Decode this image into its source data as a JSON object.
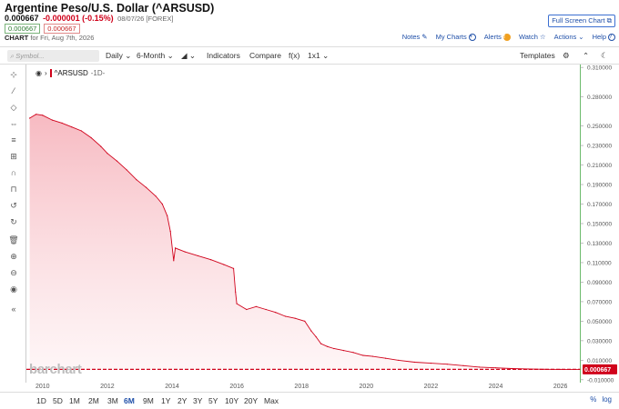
{
  "header": {
    "title": "Argentine Peso/U.S. Dollar (^ARSUSD)",
    "last": "0.000667",
    "change": "-0.000001 (-0.15%)",
    "meta": "08/07/26 [FOREX]",
    "bid": "0.000667",
    "ask": "0.000667",
    "chart_label": "CHART",
    "chart_date": "for Fri, Aug 7th, 2026",
    "fullscreen_label": "Full Screen Chart",
    "links": {
      "notes": "Notes",
      "mycharts": "My Charts",
      "alerts": "Alerts",
      "watch": "Watch",
      "actions": "Actions",
      "help": "Help"
    }
  },
  "toolbar": {
    "symbol_placeholder": "Symbol...",
    "period": "Daily",
    "range": "6-Month",
    "indicators": "Indicators",
    "compare": "Compare",
    "fx": "f(x)",
    "layout": "1x1",
    "templates": "Templates"
  },
  "legend": {
    "symbol": "^ARSUSD",
    "timeframe": "-1D-"
  },
  "watermark": "barchart",
  "ranges": [
    "1D",
    "5D",
    "1M",
    "2M",
    "3M",
    "6M",
    "9M",
    "1Y",
    "2Y",
    "3Y",
    "5Y",
    "10Y",
    "20Y",
    "Max"
  ],
  "active_range": "6M",
  "bottom_links": {
    "log": "log"
  },
  "colors": {
    "line": "#d0021b",
    "fill": "#f9cfd4",
    "accent": "#1f4fa8",
    "last_price_tag": "#d0021b"
  },
  "chart_data": {
    "type": "area",
    "title": "",
    "xlabel": "",
    "ylabel": "",
    "xlim": [
      2009.5,
      2026.6
    ],
    "ylim": [
      -0.012,
      0.312
    ],
    "y_ticks": [
      "0.310000",
      "0.280000",
      "0.250000",
      "0.230000",
      "0.210000",
      "0.190000",
      "0.170000",
      "0.150000",
      "0.130000",
      "0.110000",
      "0.090000",
      "0.070000",
      "0.050000",
      "0.030000",
      "0.010000",
      "-0.010000"
    ],
    "y_tick_values": [
      0.31,
      0.28,
      0.25,
      0.23,
      0.21,
      0.19,
      0.17,
      0.15,
      0.13,
      0.11,
      0.09,
      0.07,
      0.05,
      0.03,
      0.01,
      -0.01
    ],
    "x_ticks": [
      "2010",
      "2012",
      "2014",
      "2016",
      "2018",
      "2020",
      "2022",
      "2024",
      "2026"
    ],
    "x_tick_values": [
      2010,
      2012,
      2014,
      2016,
      2018,
      2020,
      2022,
      2024,
      2026
    ],
    "last_value": 0.000667,
    "last_value_label": "0.000667",
    "series": [
      {
        "name": "^ARSUSD",
        "x": [
          2009.6,
          2009.8,
          2010.0,
          2010.3,
          2010.6,
          2010.9,
          2011.2,
          2011.5,
          2011.8,
          2012.0,
          2012.3,
          2012.6,
          2012.9,
          2013.2,
          2013.5,
          2013.7,
          2013.85,
          2013.95,
          2014.05,
          2014.1,
          2014.4,
          2014.8,
          2015.2,
          2015.6,
          2015.9,
          2015.96,
          2016.0,
          2016.3,
          2016.6,
          2016.9,
          2017.2,
          2017.5,
          2017.8,
          2018.1,
          2018.3,
          2018.45,
          2018.6,
          2018.8,
          2019.0,
          2019.3,
          2019.6,
          2019.9,
          2020.2,
          2020.6,
          2021.0,
          2021.5,
          2022.0,
          2022.5,
          2023.0,
          2023.5,
          2024.0,
          2024.5,
          2025.0,
          2025.5,
          2026.0,
          2026.6
        ],
        "y": [
          0.258,
          0.262,
          0.261,
          0.256,
          0.253,
          0.249,
          0.245,
          0.238,
          0.229,
          0.222,
          0.214,
          0.205,
          0.195,
          0.187,
          0.178,
          0.17,
          0.158,
          0.142,
          0.112,
          0.125,
          0.121,
          0.117,
          0.113,
          0.108,
          0.104,
          0.08,
          0.068,
          0.062,
          0.065,
          0.062,
          0.059,
          0.055,
          0.053,
          0.05,
          0.04,
          0.034,
          0.027,
          0.024,
          0.022,
          0.02,
          0.018,
          0.015,
          0.014,
          0.012,
          0.01,
          0.008,
          0.007,
          0.006,
          0.0045,
          0.003,
          0.0022,
          0.0015,
          0.001,
          0.0008,
          0.0007,
          0.000667
        ]
      }
    ]
  }
}
